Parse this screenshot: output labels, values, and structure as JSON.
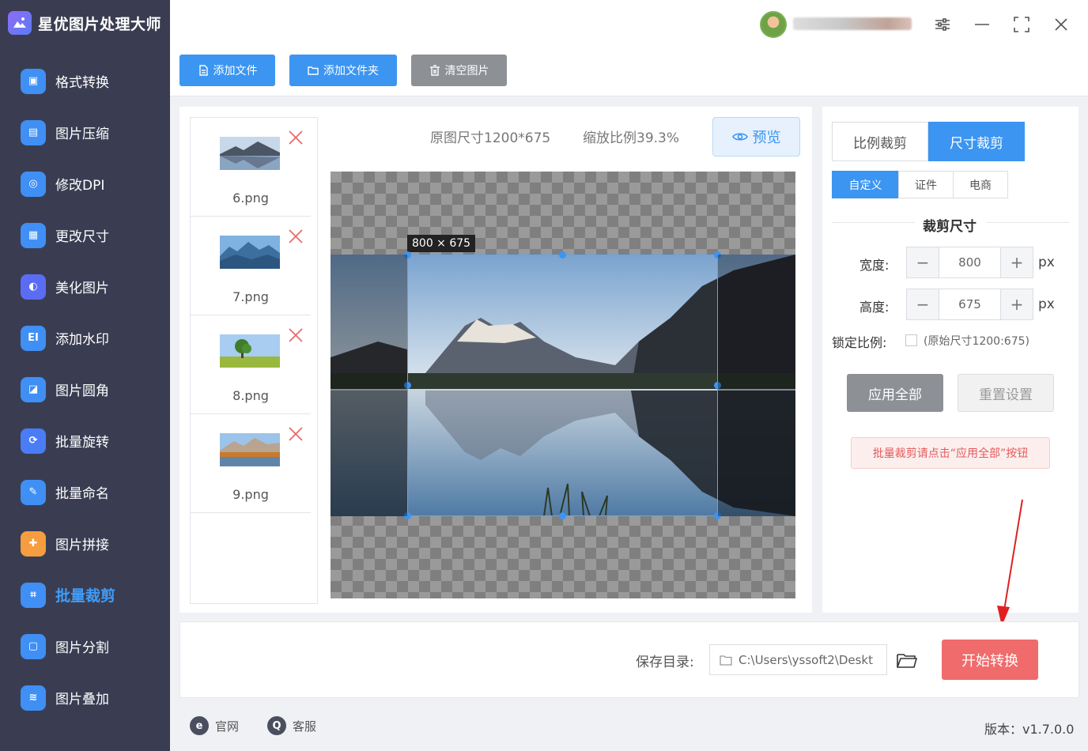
{
  "app": {
    "title": "星优图片处理大师"
  },
  "sidebar": {
    "items": [
      {
        "label": "格式转换",
        "icon": "image-convert-icon",
        "color": "#3f8ff5"
      },
      {
        "label": "图片压缩",
        "icon": "compress-icon",
        "color": "#3f8ff5"
      },
      {
        "label": "修改DPI",
        "icon": "dpi-icon",
        "color": "#3f8ff5"
      },
      {
        "label": "更改尺寸",
        "icon": "resize-icon",
        "color": "#3f8ff5"
      },
      {
        "label": "美化图片",
        "icon": "beautify-icon",
        "color": "#5b6cf4"
      },
      {
        "label": "添加水印",
        "icon": "watermark-icon",
        "color": "#3f8ff5"
      },
      {
        "label": "图片圆角",
        "icon": "round-corner-icon",
        "color": "#3f8ff5"
      },
      {
        "label": "批量旋转",
        "icon": "rotate-icon",
        "color": "#4a7cf5"
      },
      {
        "label": "批量命名",
        "icon": "rename-icon",
        "color": "#3f8ff5"
      },
      {
        "label": "图片拼接",
        "icon": "puzzle-icon",
        "color": "#f59d3f"
      },
      {
        "label": "批量裁剪",
        "icon": "crop-icon",
        "color": "#3f8ff5",
        "active": true
      },
      {
        "label": "图片分割",
        "icon": "split-icon",
        "color": "#3f8ff5"
      },
      {
        "label": "图片叠加",
        "icon": "layers-icon",
        "color": "#3f8ff5"
      }
    ]
  },
  "toolbar": {
    "add_file": "添加文件",
    "add_folder": "添加文件夹",
    "clear": "清空图片"
  },
  "files": [
    {
      "name": "6.png",
      "thumb": "lake-mountain"
    },
    {
      "name": "7.png",
      "thumb": "blue-mountains"
    },
    {
      "name": "8.png",
      "thumb": "green-tree"
    },
    {
      "name": "9.png",
      "thumb": "autumn-mountain"
    }
  ],
  "preview": {
    "original_size": "原图尺寸1200*675",
    "scale": "缩放比例39.3%",
    "preview_label": "预览",
    "crop_label": "800 × 675"
  },
  "crop_panel": {
    "mode_tabs": [
      "比例裁剪",
      "尺寸裁剪"
    ],
    "active_mode": "尺寸裁剪",
    "sub_tabs": [
      "自定义",
      "证件",
      "电商"
    ],
    "active_sub": "自定义",
    "section_title": "裁剪尺寸",
    "width_label": "宽度:",
    "width_value": "800",
    "height_label": "高度:",
    "height_value": "675",
    "unit": "px",
    "lock_label": "锁定比例:",
    "lock_hint": "(原始尺寸1200:675)",
    "lock_checked": false,
    "apply_all": "应用全部",
    "reset": "重置设置",
    "tip": "批量裁剪请点击“应用全部”按钮"
  },
  "output": {
    "save_label": "保存目录:",
    "save_path": "C:\\Users\\yssoft2\\Deskt",
    "start": "开始转换"
  },
  "footer": {
    "website": "官网",
    "service": "客服",
    "version": "版本：v1.7.0.0"
  },
  "colors": {
    "accent": "#3c95f1",
    "sidebar_bg": "#3a3d52",
    "start": "#f06b6b"
  }
}
